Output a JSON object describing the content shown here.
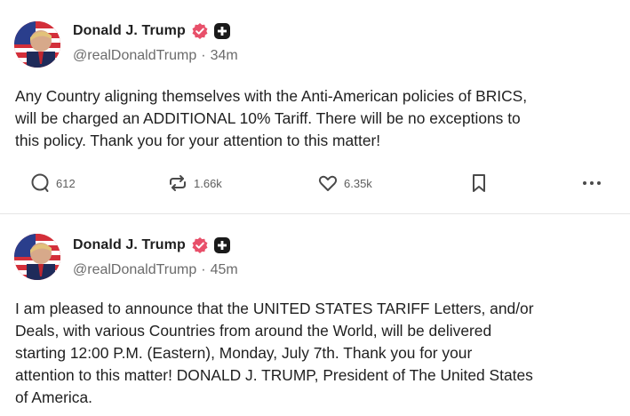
{
  "posts": [
    {
      "author_name": "Donald J. Trump",
      "handle": "@realDonaldTrump",
      "separator": "·",
      "time": "34m",
      "text": "Any Country aligning themselves with the Anti-American policies of BRICS,\nwill be charged an ADDITIONAL 10% Tariff. There will be no exceptions to\nthis policy. Thank you for your attention to this matter!",
      "replies": "612",
      "retruths": "1.66k",
      "likes": "6.35k"
    },
    {
      "author_name": "Donald J. Trump",
      "handle": "@realDonaldTrump",
      "separator": "·",
      "time": "45m",
      "text": "I am pleased to announce that the UNITED STATES TARIFF Letters, and/or\nDeals, with various Countries from around the World, will be delivered\nstarting 12:00 P.M. (Eastern), Monday, July 7th. Thank you for your\nattention to this matter! DONALD J. TRUMP, President of The United States\nof America."
    }
  ],
  "icons": {
    "verified": "verified-badge-icon",
    "plus": "plus-badge-icon",
    "reply": "comment-icon",
    "retruth": "repost-icon",
    "like": "heart-icon",
    "save": "bookmark-icon",
    "more": "more-dots-icon"
  },
  "colors": {
    "verified": "#e8506a",
    "badge_dark": "#1a1a1a",
    "avatar_red": "#d32f3a",
    "avatar_blue": "#2a3e8c"
  }
}
